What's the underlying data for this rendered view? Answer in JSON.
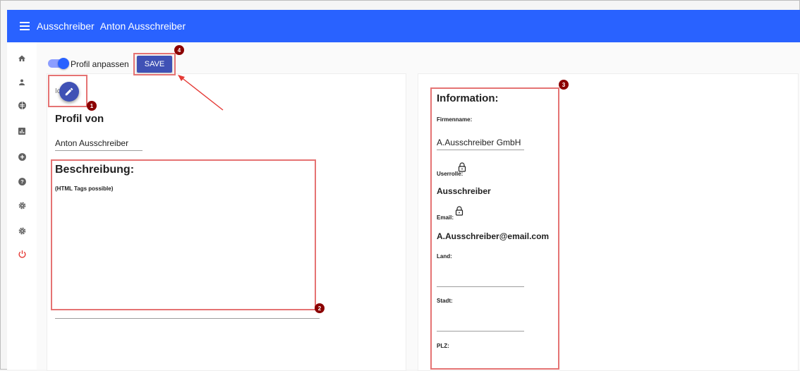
{
  "appbar": {
    "title": "Ausschreiber",
    "user": "Anton Ausschreiber"
  },
  "sidebar": {
    "items": [
      {
        "icon": "home-icon"
      },
      {
        "icon": "person-icon"
      },
      {
        "icon": "globe-icon"
      },
      {
        "icon": "bar-chart-icon"
      },
      {
        "icon": "add-circle-icon"
      },
      {
        "icon": "help-icon"
      },
      {
        "icon": "settings-icon"
      },
      {
        "icon": "settings-icon"
      },
      {
        "icon": "power-icon"
      }
    ]
  },
  "toolbar": {
    "toggle_label": "Profil anpassen",
    "save_label": "SAVE"
  },
  "profile": {
    "icon_label_fragment": "Ic",
    "heading": "Profil von",
    "name_value": "Anton Ausschreiber",
    "description_heading": "Beschreibung:",
    "description_hint": "(HTML Tags possible)"
  },
  "info": {
    "heading": "Information:",
    "company_label": "Firmenname:",
    "company_value": "A.Ausschreiber GmbH",
    "role_label": "Userrolle:",
    "role_value": "Ausschreiber",
    "email_label": "Email:",
    "email_value": "A.Ausschreiber@email.com",
    "country_label": "Land:",
    "city_label": "Stadt:",
    "zip_label": "PLZ:"
  },
  "annotations": {
    "badge1": "1",
    "badge2": "2",
    "badge3": "3",
    "badge4": "4"
  },
  "colors": {
    "appbar": "#2962ff",
    "button": "#3f51b5",
    "annotation_box": "#e57373",
    "annotation_badge": "#8b0000",
    "power_icon": "#e53935"
  }
}
